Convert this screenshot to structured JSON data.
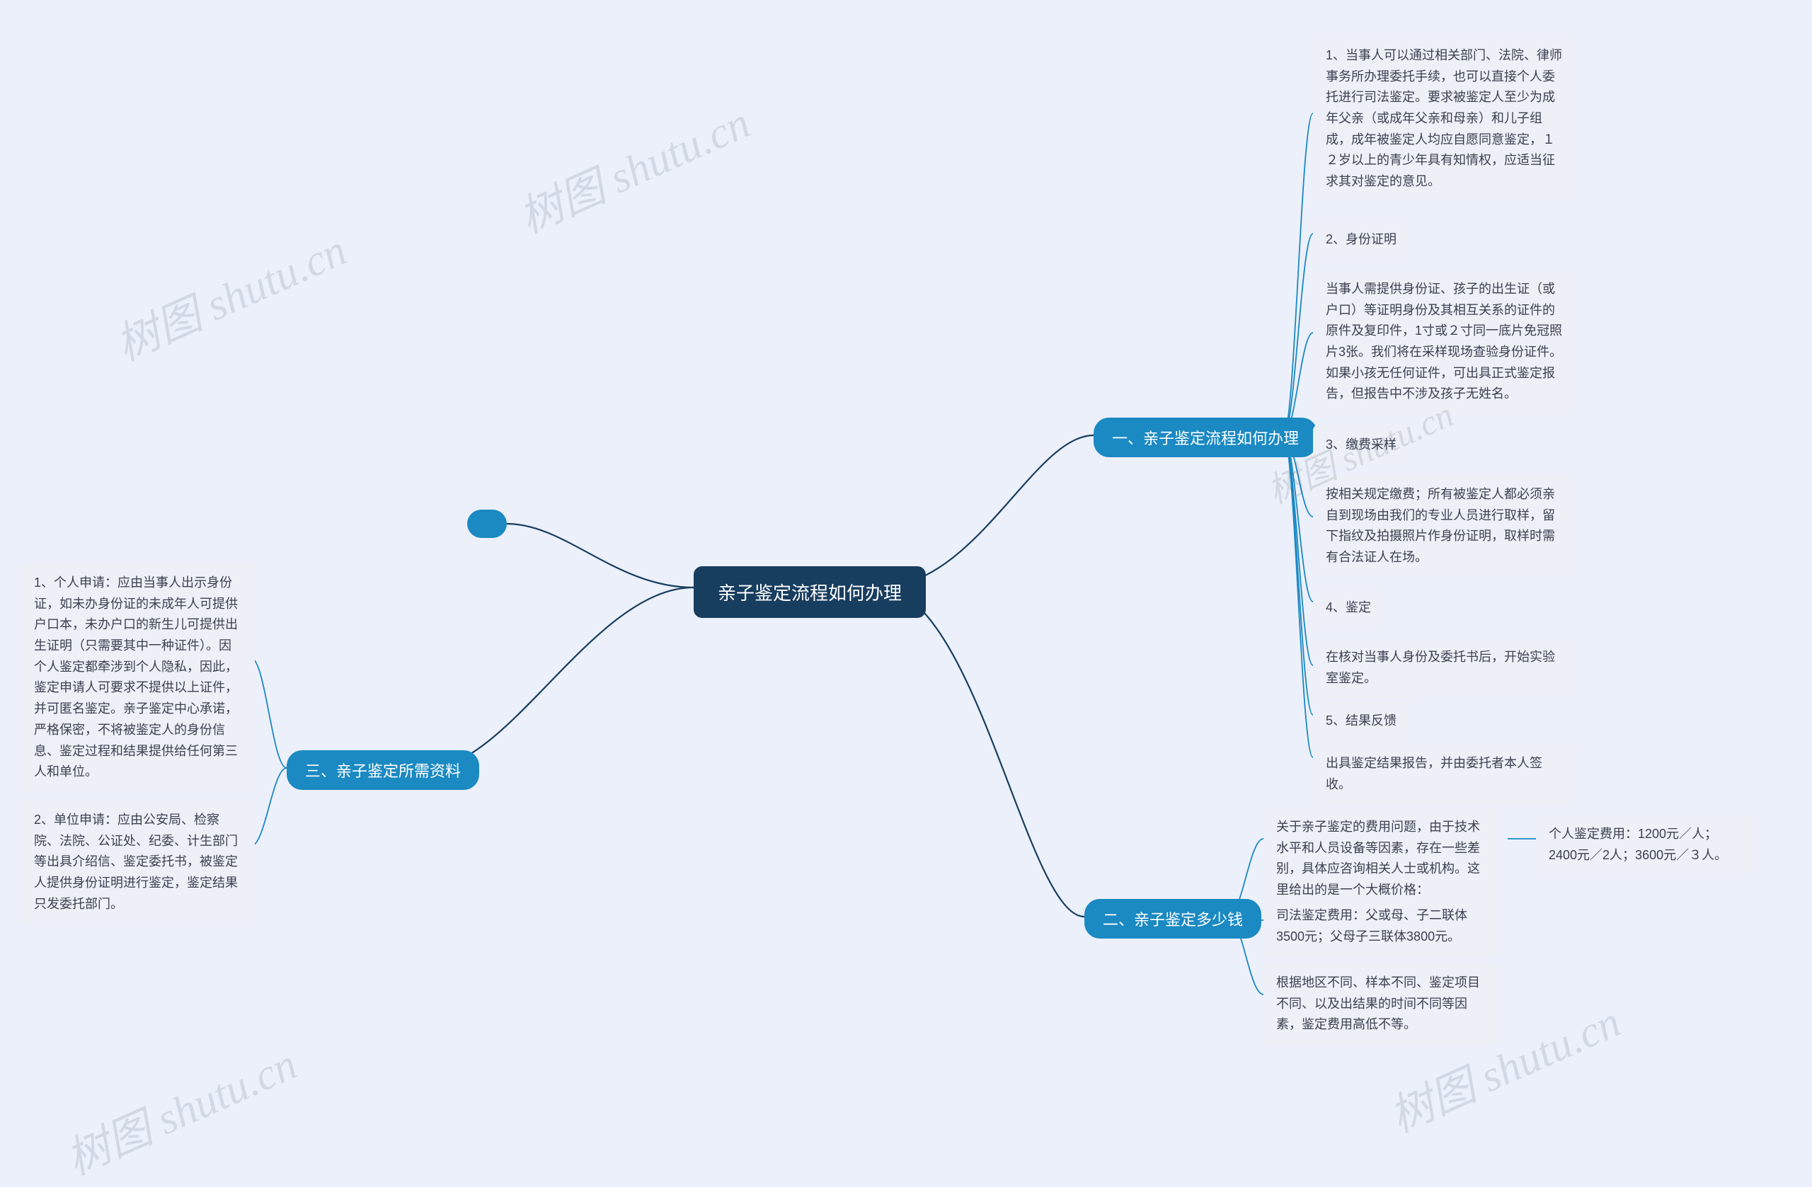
{
  "center": {
    "title": "亲子鉴定流程如何办理"
  },
  "branch1": {
    "title": "一、亲子鉴定流程如何办理",
    "items": [
      "1、当事人可以通过相关部门、法院、律师事务所办理委托手续，也可以直接个人委托进行司法鉴定。要求被鉴定人至少为成年父亲（或成年父亲和母亲）和儿子组成，成年被鉴定人均应自愿同意鉴定，１２岁以上的青少年具有知情权，应适当征求其对鉴定的意见。",
      "2、身份证明",
      "当事人需提供身份证、孩子的出生证（或户口）等证明身份及其相互关系的证件的原件及复印件，1寸或２寸同一底片免冠照片3张。我们将在采样现场查验身份证件。如果小孩无任何证件，可出具正式鉴定报告，但报告中不涉及孩子无姓名。",
      "3、缴费采样",
      "按相关规定缴费；所有被鉴定人都必须亲自到现场由我们的专业人员进行取样，留下指纹及拍摄照片作身份证明，取样时需有合法证人在场。",
      "4、鉴定",
      "在核对当事人身份及委托书后，开始实验室鉴定。",
      "5、结果反馈",
      "出具鉴定结果报告，并由委托者本人签收。"
    ]
  },
  "branch2": {
    "title": "二、亲子鉴定多少钱",
    "items": [
      "关于亲子鉴定的费用问题，由于技术水平和人员设备等因素，存在一些差别，具体应咨询相关人士或机构。这里给出的是一个大概价格：",
      "司法鉴定费用：父或母、子二联体3500元；父母子三联体3800元。",
      "根据地区不同、样本不同、鉴定项目不同、以及出结果的时间不同等因素，鉴定费用高低不等。"
    ],
    "sub": "个人鉴定费用：1200元／人；2400元／2人；3600元／３人。"
  },
  "branch3": {
    "title": "三、亲子鉴定所需资料",
    "items": [
      "1、个人申请：应由当事人出示身份证，如未办身份证的未成年人可提供户口本，未办户口的新生儿可提供出生证明（只需要其中一种证件）。因个人鉴定都牵涉到个人隐私，因此，鉴定申请人可要求不提供以上证件，并可匿名鉴定。亲子鉴定中心承诺，严格保密，不将被鉴定人的身份信息、鉴定过程和结果提供给任何第三人和单位。",
      "2、单位申请：应由公安局、检察院、法院、公证处、纪委、计生部门等出具介绍信、鉴定委托书，被鉴定人提供身份证明进行鉴定，鉴定结果只发委托部门。"
    ]
  },
  "watermark": "树图 shutu.cn"
}
